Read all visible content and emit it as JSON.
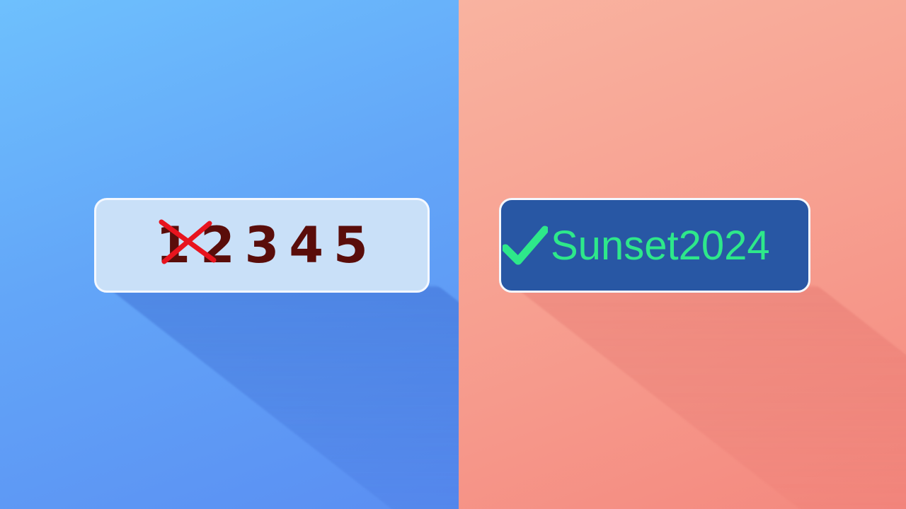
{
  "weak_password": {
    "text": "12345",
    "status_icon": "red-cross-icon"
  },
  "strong_password": {
    "text": "Sunset2024",
    "status_icon": "green-check-icon"
  },
  "colors": {
    "left_panel": "#63a6f8",
    "right_panel": "#f79f90",
    "weak_field_bg": "#c9e0f8",
    "weak_text": "#5a0d0a",
    "cross": "#e8141e",
    "strong_field_bg": "#2857a4",
    "strong_text": "#2ee88a"
  }
}
